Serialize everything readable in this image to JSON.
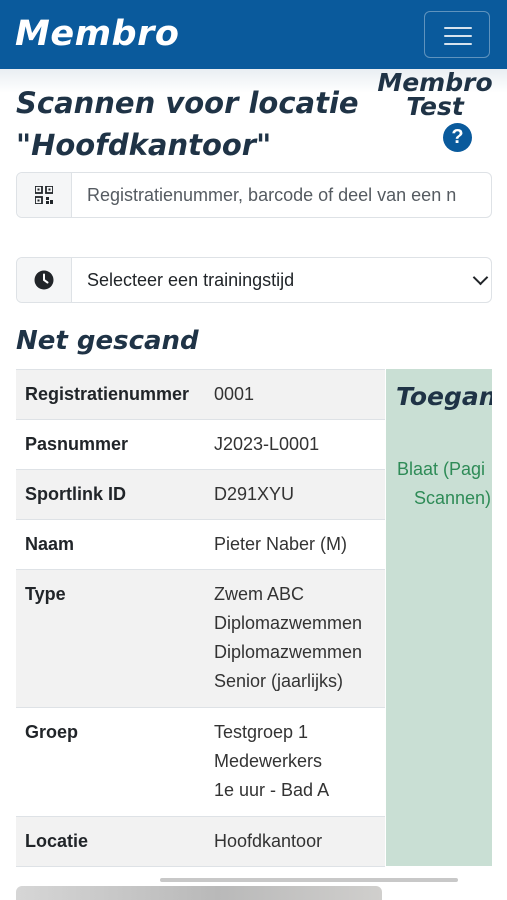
{
  "navbar": {
    "brand": "Membro",
    "menu_icon": "hamburger-icon"
  },
  "page": {
    "title_line1": "Scannen voor locatie",
    "title_line2": "\"Hoofdkantoor\"",
    "logo_line1": "Membro",
    "logo_line2": "Test",
    "help_glyph": "?"
  },
  "scan_input": {
    "icon": "qr-code-icon",
    "placeholder": "Registratienummer, barcode of deel van een n"
  },
  "training_select": {
    "icon": "clock-icon",
    "selected": "Selecteer een trainingstijd",
    "caret": "chevron-down-icon"
  },
  "recent": {
    "title": "Net gescand",
    "rows": [
      {
        "label": "Registratienummer",
        "values": [
          "0001"
        ]
      },
      {
        "label": "Pasnummer",
        "values": [
          "J2023-L0001"
        ]
      },
      {
        "label": "Sportlink ID",
        "values": [
          "D291XYU"
        ]
      },
      {
        "label": "Naam",
        "values": [
          "Pieter Naber (M)"
        ]
      },
      {
        "label": "Type",
        "values": [
          "Zwem ABC",
          "Diplomazwemmen",
          "Diplomazwemmen",
          "Senior (jaarlijks)"
        ]
      },
      {
        "label": "Groep",
        "values": [
          "Testgroep 1",
          "Medewerkers",
          "1e uur - Bad A"
        ]
      },
      {
        "label": "Locatie",
        "values": [
          "Hoofdkantoor"
        ]
      }
    ]
  },
  "access_panel": {
    "title": "Toegang",
    "lines": [
      "Blaat (Pagi",
      "Scannen)"
    ],
    "bg_color": "#c9dfd4",
    "text_color": "#2e8b57"
  },
  "colors": {
    "navbar": "#0a5a9c",
    "heading": "#1f3346"
  }
}
